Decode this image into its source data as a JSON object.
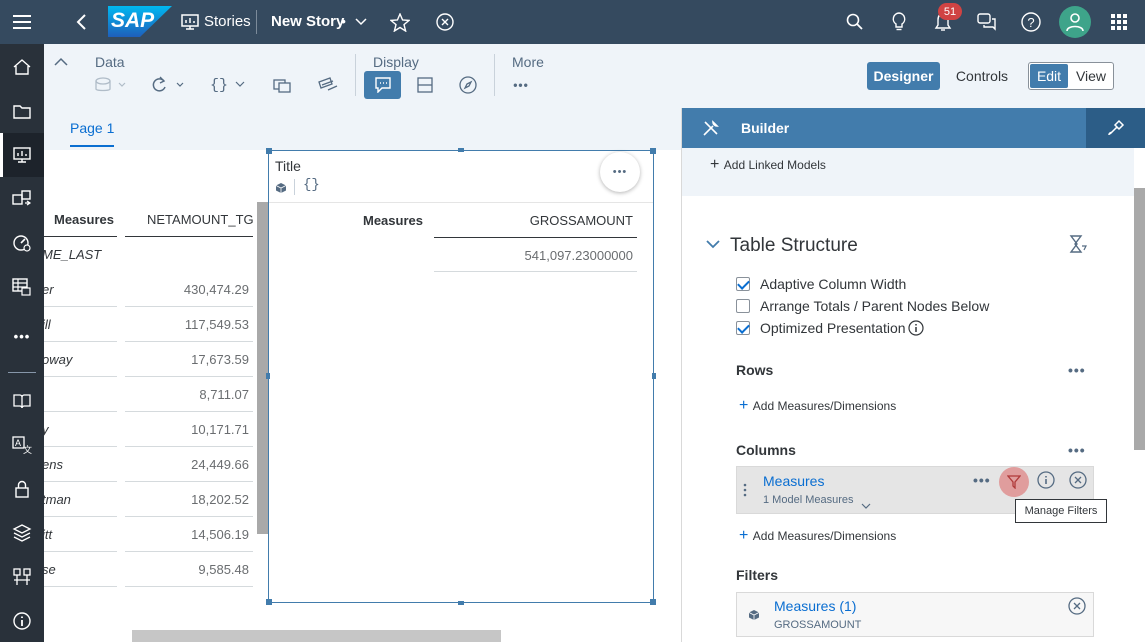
{
  "shell": {
    "logo": "SAP",
    "nav_title": "Stories",
    "story_title": "New Story",
    "story_modified_marker": "•",
    "notifications_count": "51"
  },
  "sidebar": {
    "items": [
      "home-icon",
      "folder-icon",
      "stories-icon",
      "data-modeler-icon",
      "analytic-app-icon",
      "datasets-icon",
      "more-icon",
      "catalog-icon",
      "translation-icon",
      "security-icon",
      "deployment-icon",
      "connections-icon",
      "info-icon"
    ]
  },
  "toolbar": {
    "data_label": "Data",
    "display_label": "Display",
    "more_label": "More",
    "designer_label": "Designer",
    "controls_label": "Controls",
    "edit_label": "Edit",
    "view_label": "View"
  },
  "page": {
    "tab_label": "Page 1"
  },
  "left_table": {
    "col_measures": "Measures",
    "col_net": "NETAMOUNT_TG",
    "group_label": "ME_LAST",
    "rows": [
      {
        "name": "er",
        "value": "430,474.29"
      },
      {
        "name": "ill",
        "value": "117,549.53"
      },
      {
        "name": "oway",
        "value": "17,673.59"
      },
      {
        "name": "",
        "value": "8,711.07"
      },
      {
        "name": "y",
        "value": "10,171.71"
      },
      {
        "name": "ens",
        "value": "24,449.66"
      },
      {
        "name": "tman",
        "value": "18,202.52"
      },
      {
        "name": "itt",
        "value": "14,506.19"
      },
      {
        "name": "se",
        "value": "9,585.48"
      }
    ]
  },
  "widget": {
    "title": "Title",
    "more": "•••",
    "col_measures": "Measures",
    "col_gross": "GROSSAMOUNT",
    "value": "541,097.23000000"
  },
  "builder": {
    "header": "Builder",
    "add_linked_models": "Add Linked Models",
    "section_title": "Table Structure",
    "options": [
      {
        "label": "Adaptive Column Width",
        "checked": true
      },
      {
        "label": "Arrange Totals / Parent Nodes Below",
        "checked": false
      },
      {
        "label": "Optimized Presentation",
        "checked": true
      }
    ],
    "rows_label": "Rows",
    "columns_label": "Columns",
    "filters_label": "Filters",
    "add_measures_dimensions": "Add Measures/Dimensions",
    "columns_item": {
      "title": "Measures",
      "subtitle": "1 Model Measures"
    },
    "filter_item": {
      "title": "Measures (1)",
      "subtitle": "GROSSAMOUNT"
    },
    "tooltip": "Manage Filters"
  },
  "colors": {
    "shell": "#354a5f",
    "sidebar": "#29313a",
    "accent": "#0a6ed1",
    "builder_header": "#427cac"
  }
}
